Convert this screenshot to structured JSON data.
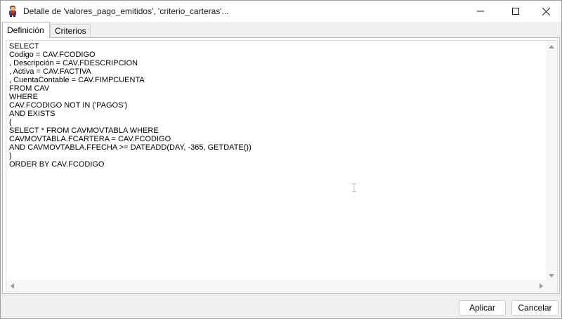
{
  "window": {
    "title": "Detalle de 'valores_pago_emitidos', 'criterio_carteras'...",
    "icon": "app-figure-icon",
    "controls": {
      "minimize_icon": "minimize-icon",
      "maximize_icon": "maximize-icon",
      "close_icon": "close-icon"
    }
  },
  "tabs": [
    {
      "label": "Definición",
      "selected": true
    },
    {
      "label": "Criterios",
      "selected": false
    }
  ],
  "editor": {
    "lines": [
      "SELECT",
      "Codigo = CAV.FCODIGO",
      ", Descripción = CAV.FDESCRIPCION",
      ", Activa = CAV.FACTIVA",
      ", CuentaContable = CAV.FIMPCUENTA",
      "FROM CAV",
      "WHERE",
      "CAV.FCODIGO NOT IN ('PAGOS')",
      "AND EXISTS",
      "(",
      "SELECT * FROM CAVMOVTABLA WHERE",
      "CAVMOVTABLA.FCARTERA = CAV.FCODIGO",
      "AND CAVMOVTABLA.FFECHA >= DATEADD(DAY, -365, GETDATE())",
      ")",
      "ORDER BY CAV.FCODIGO"
    ]
  },
  "buttons": {
    "apply_label": "Aplicar",
    "cancel_label": "Cancelar"
  }
}
